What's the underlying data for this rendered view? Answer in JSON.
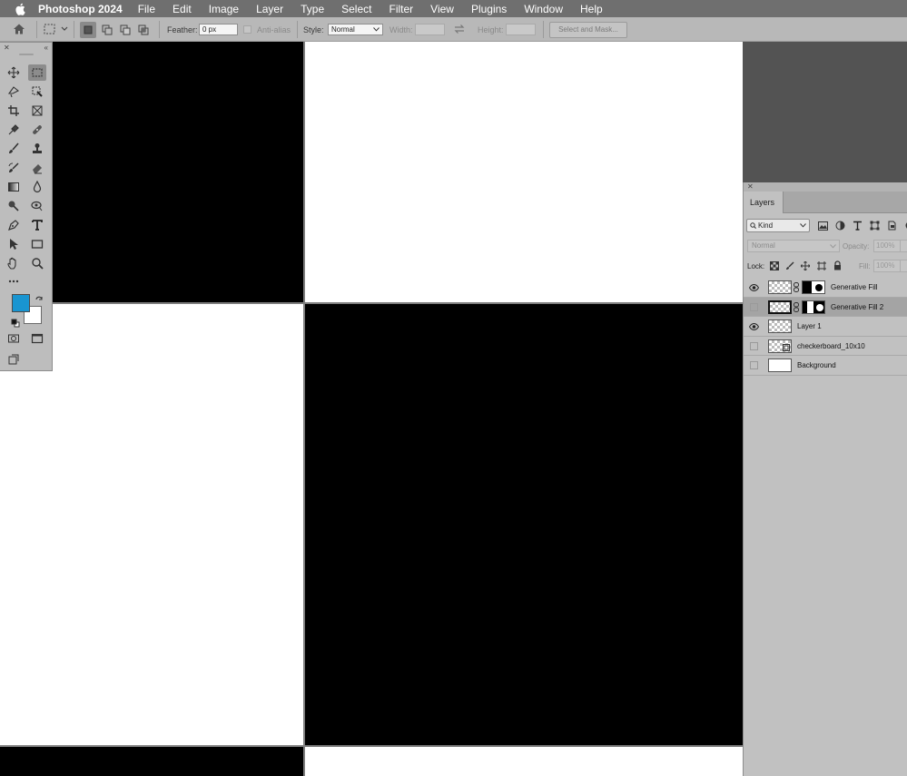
{
  "menubar": {
    "app_name": "Photoshop 2024",
    "menus": [
      "File",
      "Edit",
      "Image",
      "Layer",
      "Type",
      "Select",
      "Filter",
      "View",
      "Plugins",
      "Window",
      "Help"
    ]
  },
  "options_bar": {
    "feather_label": "Feather:",
    "feather_value": "0 px",
    "anti_alias_label": "Anti-alias",
    "style_label": "Style:",
    "style_value": "Normal",
    "width_label": "Width:",
    "height_label": "Height:",
    "select_and_mask_label": "Select and Mask..."
  },
  "tools_panel": {
    "foreground_color": "#1995d1",
    "background_color": "#ffffff"
  },
  "layers_panel": {
    "tab_label": "Layers",
    "filter_kind": "Kind",
    "blend_mode": "Normal",
    "opacity_label": "Opacity:",
    "opacity_value": "100%",
    "lock_label": "Lock:",
    "fill_label": "Fill:",
    "fill_value": "100%",
    "layers": [
      {
        "name": "Generative Fill",
        "visible": true,
        "selected": false,
        "has_mask": true
      },
      {
        "name": "Generative Fill 2",
        "visible": false,
        "selected": true,
        "has_mask": true
      },
      {
        "name": "Layer 1",
        "visible": true,
        "selected": false,
        "has_mask": false
      },
      {
        "name": "checkerboard_10x10",
        "visible": false,
        "selected": false,
        "has_mask": false
      },
      {
        "name": "Background",
        "visible": false,
        "selected": false,
        "has_mask": false
      }
    ]
  },
  "colors": {
    "menubar": "#6f6f6f",
    "panel": "#bdbdbd",
    "accent": "#1995d1"
  }
}
